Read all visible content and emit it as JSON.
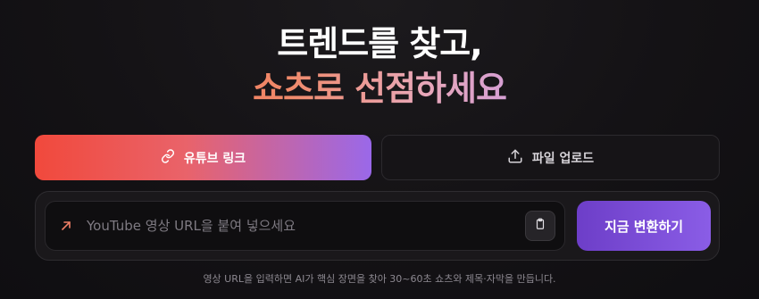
{
  "hero": {
    "line1": "트렌드를 찾고,",
    "line2": "쇼츠로 선점하세요"
  },
  "tabs": [
    {
      "label": "유튜브 링크",
      "icon": "link-icon",
      "active": true
    },
    {
      "label": "파일 업로드",
      "icon": "upload-icon",
      "active": false
    }
  ],
  "input": {
    "placeholder": "YouTube 영상 URL을 붙여 넣으세요",
    "value": "",
    "icon": "arrow-up-right-icon",
    "paste_icon": "clipboard-icon"
  },
  "convert_button": {
    "label": "지금 변환하기"
  },
  "hint": "영상 URL을 입력하면 AI가 핵심 장면을 찾아 30~60초 쇼츠와 제목·자막을 만듭니다.",
  "colors": {
    "background": "#131114",
    "accent_red": "#f1493c",
    "accent_purple": "#8a5de6"
  }
}
